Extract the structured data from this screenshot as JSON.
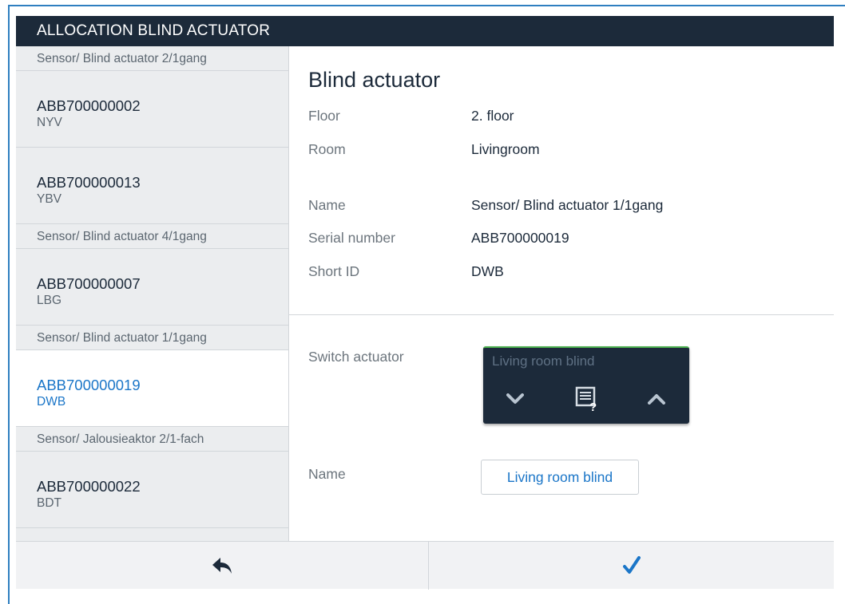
{
  "window": {
    "title": "ALLOCATION BLIND ACTUATOR"
  },
  "sidebar": {
    "groups": [
      {
        "header": "Sensor/ Blind actuator 2/1gang",
        "devices": [
          {
            "serial": "ABB700000002",
            "short_id": "NYV"
          },
          {
            "serial": "ABB700000013",
            "short_id": "YBV"
          }
        ]
      },
      {
        "header": "Sensor/ Blind actuator 4/1gang",
        "devices": [
          {
            "serial": "ABB700000007",
            "short_id": "LBG"
          }
        ]
      },
      {
        "header": "Sensor/ Blind actuator 1/1gang",
        "devices": [
          {
            "serial": "ABB700000019",
            "short_id": "DWB",
            "selected": true
          }
        ]
      },
      {
        "header": "Sensor/ Jalousieaktor 2/1-fach",
        "devices": [
          {
            "serial": "ABB700000022",
            "short_id": "BDT"
          }
        ]
      }
    ]
  },
  "detail": {
    "title": "Blind actuator",
    "floor_label": "Floor",
    "floor_value": "2. floor",
    "room_label": "Room",
    "room_value": "Livingroom",
    "name_label": "Name",
    "name_value": "Sensor/ Blind actuator 1/1gang",
    "serial_label": "Serial number",
    "serial_value": "ABB700000019",
    "shortid_label": "Short ID",
    "shortid_value": "DWB",
    "switch_label": "Switch actuator",
    "tile_name": "Living room blind",
    "channel_name_label": "Name",
    "channel_name_value": "Living room blind"
  },
  "colors": {
    "titlebar": "#1c2a3a",
    "accent": "#1b76c8",
    "tile_status": "#4caf50"
  },
  "icons": {
    "back": "back-arrow-icon",
    "confirm": "checkmark-icon",
    "down": "chevron-down-icon",
    "up": "chevron-up-icon",
    "help": "document-question-icon"
  }
}
